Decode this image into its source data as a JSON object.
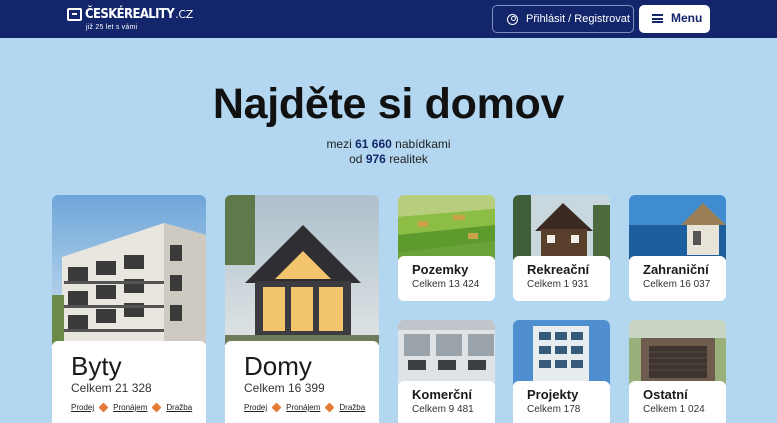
{
  "header": {
    "logo_name": "ČESKÉREALITY",
    "logo_tld": ".CZ",
    "logo_tagline": "již 25 let s vámi",
    "login_label": "Přihlásit / Registrovat",
    "menu_label": "Menu"
  },
  "hero": {
    "title": "Najděte si domov",
    "line1_prefix": "mezi",
    "offers_count": "61 660",
    "line1_suffix": "nabídkami",
    "line2_prefix": "od",
    "agencies_count": "976",
    "line2_suffix": "realitek"
  },
  "categories": {
    "byty": {
      "title": "Byty",
      "count": "Celkem 21 328",
      "links": [
        "Prodej",
        "Pronájem",
        "Dražba"
      ]
    },
    "domy": {
      "title": "Domy",
      "count": "Celkem 16 399",
      "links": [
        "Prodej",
        "Pronájem",
        "Dražba"
      ]
    },
    "pozemky": {
      "title": "Pozemky",
      "count": "Celkem 13 424"
    },
    "rekreacni": {
      "title": "Rekreační",
      "count": "Celkem 1 931"
    },
    "zahranicni": {
      "title": "Zahraniční",
      "count": "Celkem 16 037"
    },
    "komercni": {
      "title": "Komerční",
      "count": "Celkem 9 481"
    },
    "projekty": {
      "title": "Projekty",
      "count": "Celkem 178"
    },
    "ostatni": {
      "title": "Ostatní",
      "count": "Celkem 1 024"
    }
  },
  "colors": {
    "header_bg": "#13266b",
    "page_bg": "#b3d7f0",
    "accent_dot": "#e47a36"
  }
}
